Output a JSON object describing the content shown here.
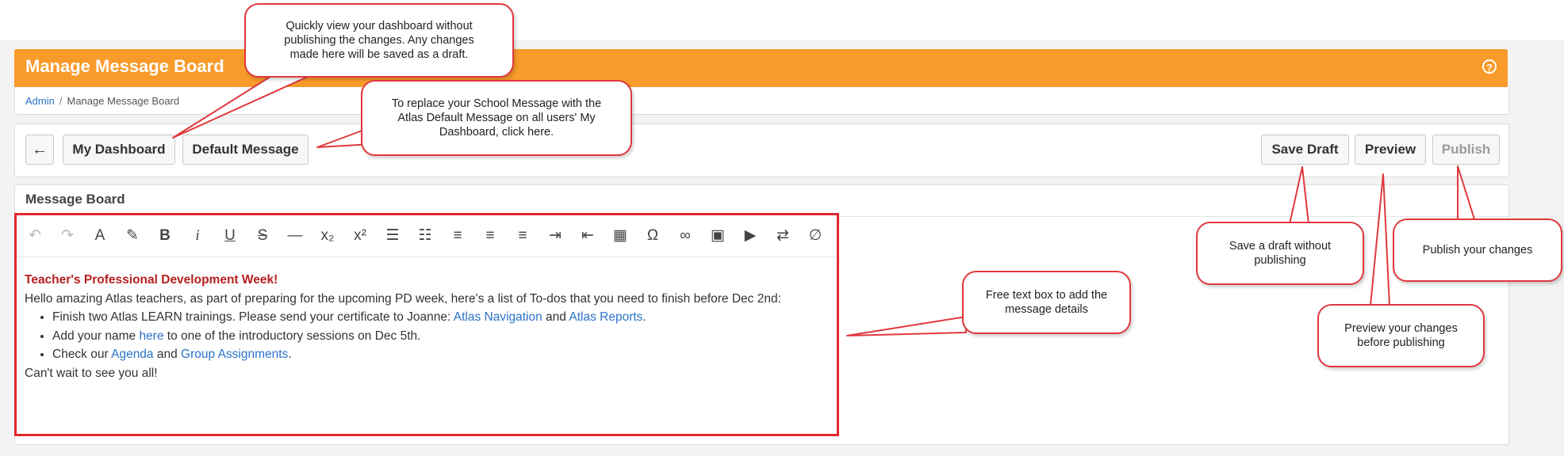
{
  "header": {
    "title": "Manage Message Board",
    "help_icon": "?"
  },
  "breadcrumb": {
    "root": "Admin",
    "separator": "/",
    "current": "Manage Message Board"
  },
  "toolbar": {
    "back_label": "←",
    "my_dashboard_label": "My Dashboard",
    "default_message_label": "Default Message",
    "save_draft_label": "Save Draft",
    "preview_label": "Preview",
    "publish_label": "Publish"
  },
  "message_board": {
    "title": "Message Board",
    "editor_tools": [
      {
        "name": "undo-icon",
        "glyph": "↶",
        "enabled": false
      },
      {
        "name": "redo-icon",
        "glyph": "↷",
        "enabled": false
      },
      {
        "name": "text-color-icon",
        "glyph": "A",
        "enabled": true
      },
      {
        "name": "highlight-icon",
        "glyph": "✎",
        "enabled": true
      },
      {
        "name": "bold-icon",
        "glyph": "B",
        "enabled": true
      },
      {
        "name": "italic-icon",
        "glyph": "i",
        "enabled": true
      },
      {
        "name": "underline-icon",
        "glyph": "U",
        "enabled": true
      },
      {
        "name": "strikethrough-icon",
        "glyph": "S",
        "enabled": true
      },
      {
        "name": "horizontal-rule-icon",
        "glyph": "—",
        "enabled": true
      },
      {
        "name": "subscript-icon",
        "glyph": "x₂",
        "enabled": true
      },
      {
        "name": "superscript-icon",
        "glyph": "x²",
        "enabled": true
      },
      {
        "name": "numbered-list-icon",
        "glyph": "☰",
        "enabled": true
      },
      {
        "name": "bullet-list-icon",
        "glyph": "☷",
        "enabled": true
      },
      {
        "name": "align-left-icon",
        "glyph": "≡",
        "enabled": true
      },
      {
        "name": "align-center-icon",
        "glyph": "≡",
        "enabled": true
      },
      {
        "name": "align-right-icon",
        "glyph": "≡",
        "enabled": true
      },
      {
        "name": "indent-icon",
        "glyph": "⇥",
        "enabled": true
      },
      {
        "name": "outdent-icon",
        "glyph": "⇤",
        "enabled": true
      },
      {
        "name": "table-icon",
        "glyph": "▦",
        "enabled": true
      },
      {
        "name": "special-character-icon",
        "glyph": "Ω",
        "enabled": true
      },
      {
        "name": "link-icon",
        "glyph": "∞",
        "enabled": true
      },
      {
        "name": "image-icon",
        "glyph": "▣",
        "enabled": true
      },
      {
        "name": "video-icon",
        "glyph": "▶",
        "enabled": true
      },
      {
        "name": "swap-direction-icon",
        "glyph": "⇄",
        "enabled": true
      },
      {
        "name": "clear-formatting-icon",
        "glyph": "∅",
        "enabled": true
      }
    ],
    "content": {
      "heading": "Teacher's Professional Development Week!",
      "intro": "Hello amazing Atlas teachers, as part of preparing for the upcoming PD week, here's a list of To-dos that you need to finish before Dec 2nd:",
      "item1_text": "Finish two Atlas LEARN trainings. Please send your certificate to Joanne: ",
      "item1_link1": "Atlas Navigation",
      "item1_and": " and ",
      "item1_link2": "Atlas Reports",
      "item1_end": ".",
      "item2_pre": "Add your name ",
      "item2_link": "here",
      "item2_post": " to one of the introductory sessions on Dec 5th.",
      "item3_pre": "Check our ",
      "item3_link1": "Agenda",
      "item3_and": " and ",
      "item3_link2": "Group Assignments",
      "item3_end": ".",
      "closing": "Can't wait to see you all!"
    }
  },
  "callouts": {
    "dashboard": "Quickly view your dashboard without publishing the changes. Any changes made here will be saved as a draft.",
    "default_message": "To replace your School Message with the Atlas Default Message on all users' My Dashboard, click here.",
    "free_text": "Free text box to add the message details",
    "save_draft": "Save a draft without publishing",
    "preview": "Preview your changes before publishing",
    "publish": "Publish your changes"
  },
  "colors": {
    "header": "#f89b2a",
    "callout_border": "#e0383d",
    "link": "#2a73c9",
    "heading": "#b5201f"
  }
}
